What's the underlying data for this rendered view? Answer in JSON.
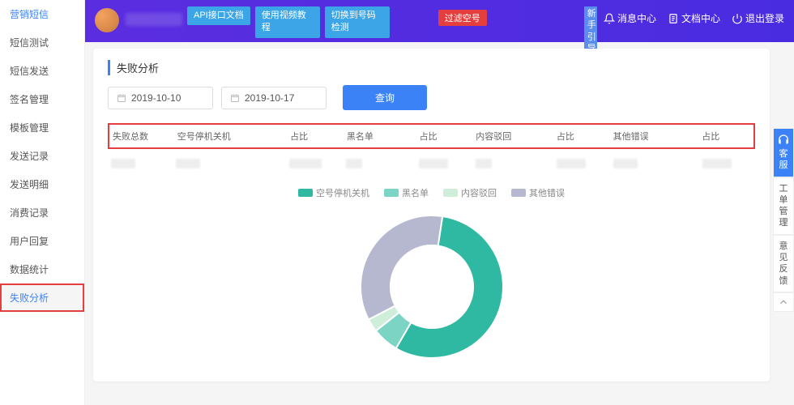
{
  "sidebar": {
    "items": [
      {
        "label": "营销短信",
        "state": "active"
      },
      {
        "label": "短信测试"
      },
      {
        "label": "短信发送"
      },
      {
        "label": "签名管理"
      },
      {
        "label": "模板管理"
      },
      {
        "label": "发送记录"
      },
      {
        "label": "发送明细"
      },
      {
        "label": "消费记录"
      },
      {
        "label": "用户回复"
      },
      {
        "label": "数据统计"
      },
      {
        "label": "失败分析",
        "state": "highlighted"
      }
    ]
  },
  "topbar": {
    "buttons": [
      "API接口文档",
      "使用视频教程",
      "切换到号码检测"
    ],
    "tag": "过滤空号",
    "guide": "新手引导",
    "links": {
      "msg": "消息中心",
      "doc": "文档中心",
      "logout": "退出登录"
    }
  },
  "panel": {
    "title": "失败分析",
    "date_from": "2019-10-10",
    "date_to": "2019-10-17",
    "query_btn": "查询"
  },
  "table": {
    "headers": [
      "失败总数",
      "空号停机关机",
      "占比",
      "黑名单",
      "占比",
      "内容驳回",
      "占比",
      "其他错误",
      "占比"
    ]
  },
  "chart_data": {
    "type": "pie",
    "inner_radius": 0.58,
    "series": [
      {
        "name": "空号停机关机",
        "value": 56,
        "color": "#2fb9a3"
      },
      {
        "name": "黑名单",
        "value": 6,
        "color": "#7bd4c4"
      },
      {
        "name": "内容驳回",
        "value": 3,
        "color": "#cfeeda"
      },
      {
        "name": "其他错误",
        "value": 35,
        "color": "#b5b8cf"
      }
    ]
  },
  "dock": {
    "cs": "客服",
    "ticket": "工单管理",
    "feedback": "意见反馈"
  }
}
